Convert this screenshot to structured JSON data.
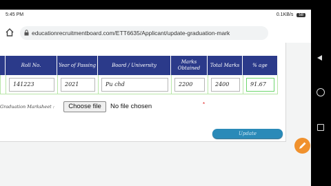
{
  "status_bar": {
    "time": "5:45 PM",
    "right": "0.1KB/s",
    "battery": "58"
  },
  "browser": {
    "url": "educationrecruitmentboard.com/ETT6635/Applicant/update-graduation-mark",
    "tab_count": "46"
  },
  "table": {
    "headers": [
      "Roll No.",
      "Year of Passing",
      "Board / University",
      "Marks Obtained",
      "Total Marks",
      "% age"
    ],
    "values": [
      "141223",
      "2021",
      "Pu chd",
      "2200",
      "2400",
      "91.67"
    ]
  },
  "upload": {
    "label": "Graduation Marksheet :",
    "button": "Choose file",
    "status": "No file chosen",
    "required_mark": "*"
  },
  "actions": {
    "update_label": "Update"
  },
  "colors": {
    "header_bg": "#2b3a8a",
    "update_bg": "#2a8ab8",
    "fab": "#f0912d"
  },
  "icons": [
    "home-icon",
    "lock-icon",
    "tabs-icon",
    "overflow-menu-icon",
    "edit-pencil-icon",
    "nav-back-icon",
    "nav-home-icon",
    "nav-recents-icon"
  ]
}
